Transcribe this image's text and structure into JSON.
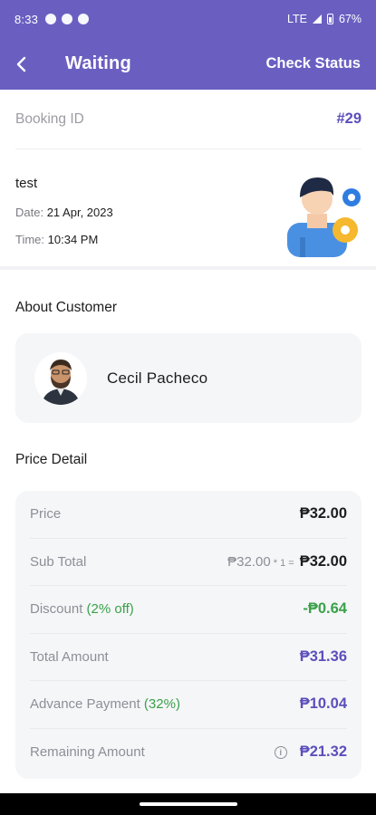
{
  "status_bar": {
    "time": "8:33",
    "network": "LTE",
    "battery": "67%"
  },
  "app_bar": {
    "title": "Waiting",
    "action": "Check Status"
  },
  "booking": {
    "label": "Booking ID",
    "id": "#29"
  },
  "service": {
    "name": "test",
    "date_label": "Date:",
    "date": "21 Apr, 2023",
    "time_label": "Time:",
    "time": "10:34 PM"
  },
  "customer": {
    "section_title": "About Customer",
    "name": "Cecil Pacheco"
  },
  "price": {
    "section_title": "Price Detail",
    "price_label": "Price",
    "price_value": "₱32.00",
    "subtotal_label": "Sub Total",
    "subtotal_calc": "₱32.00",
    "subtotal_qty": " * 1 =",
    "subtotal_value": "₱32.00",
    "discount_label": "Discount",
    "discount_note": "(2% off)",
    "discount_value": "-₱0.64",
    "total_label": "Total Amount",
    "total_value": "₱31.36",
    "advance_label": "Advance Payment",
    "advance_note": "(32%)",
    "advance_value": "₱10.04",
    "remaining_label": "Remaining Amount",
    "remaining_value": "₱21.32"
  },
  "colors": {
    "primary": "#6a5fc1",
    "accent": "#5b4fbb",
    "green": "#3aa14a"
  }
}
